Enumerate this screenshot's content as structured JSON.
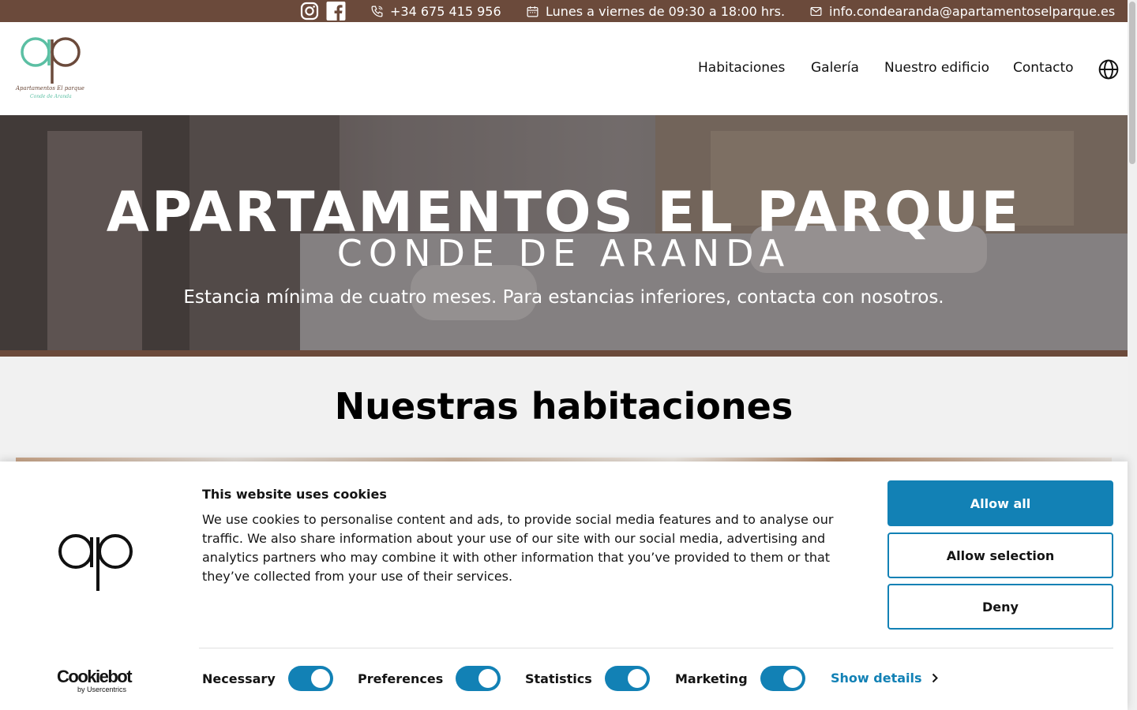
{
  "topbar": {
    "phone": "+34 675 415 956",
    "hours": "Lunes a viernes de 09:30 a 18:00 hrs.",
    "email": "info.condearanda@apartamentoselparque.es",
    "icons": [
      "instagram-icon",
      "facebook-icon",
      "phone-icon",
      "calendar-icon",
      "mail-icon"
    ],
    "bg_color": "#6b4a3b"
  },
  "header": {
    "logo": {
      "line1": "Apartamentos El parque",
      "line2": "Conde de Aranda"
    },
    "nav": [
      "Habitaciones",
      "Galería",
      "Nuestro edificio",
      "Contacto"
    ],
    "language_icon": "globe-icon"
  },
  "hero": {
    "title": "APARTAMENTOS EL PARQUE",
    "subtitle": "CONDE DE ARANDA",
    "note": "Estancia mínima de cuatro meses. Para estancias inferiores, contacta con nosotros."
  },
  "rooms_section": {
    "title": "Nuestras habitaciones"
  },
  "cookie_banner": {
    "title": "This website uses cookies",
    "body": "We use cookies to personalise content and ads, to provide social media features and to analyse our traffic. We also share information about your use of our site with our social media, advertising and analytics partners who may combine it with other information that you’ve provided to them or that they’ve collected from your use of their services.",
    "buttons": {
      "allow_all": "Allow all",
      "allow_selection": "Allow selection",
      "deny": "Deny"
    },
    "toggles": [
      {
        "label": "Necessary",
        "on": true
      },
      {
        "label": "Preferences",
        "on": true
      },
      {
        "label": "Statistics",
        "on": true
      },
      {
        "label": "Marketing",
        "on": true
      }
    ],
    "show_details": "Show details",
    "brand": {
      "name": "Cookiebot",
      "by": "by Usercentrics"
    },
    "accent_color": "#1281b5"
  }
}
